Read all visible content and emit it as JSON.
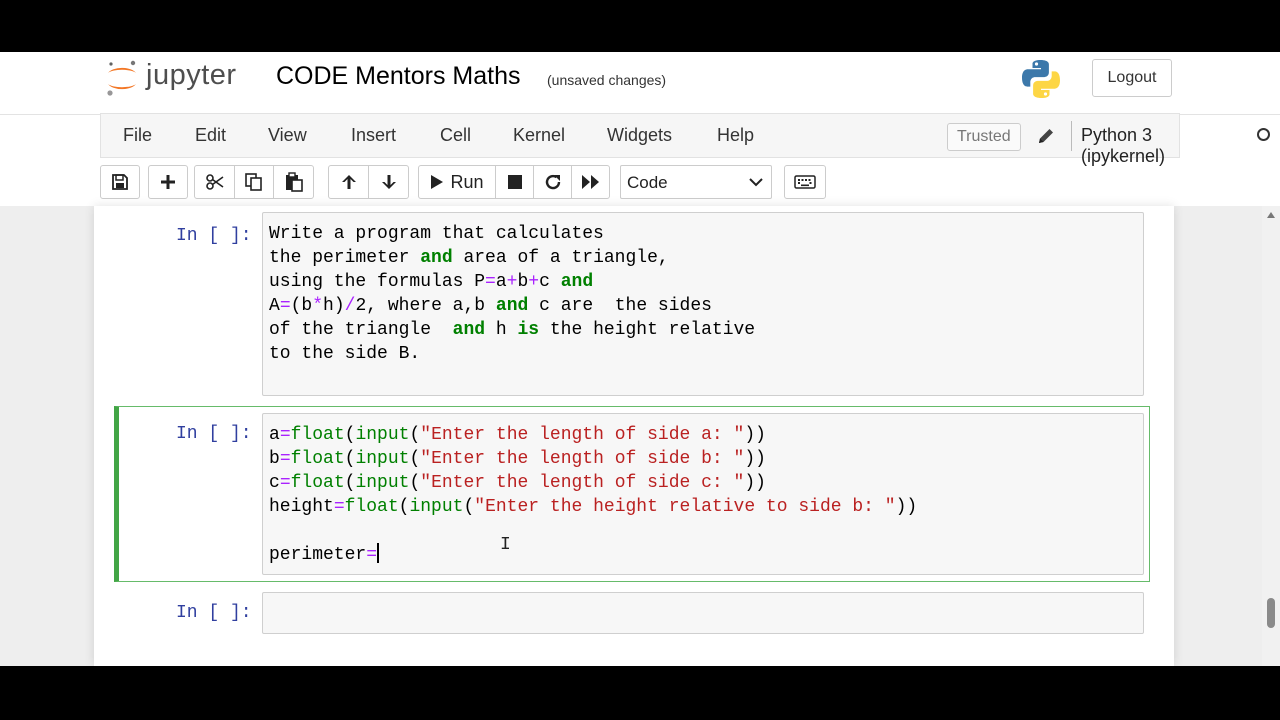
{
  "header": {
    "logo_text": "jupyter",
    "notebook_name": "CODE Mentors Maths",
    "save_status": "(unsaved changes)",
    "logout_label": "Logout"
  },
  "menubar": {
    "items": [
      "File",
      "Edit",
      "View",
      "Insert",
      "Cell",
      "Kernel",
      "Widgets",
      "Help"
    ],
    "trusted_label": "Trusted",
    "kernel_name": "Python 3 (ipykernel)"
  },
  "toolbar": {
    "run_label": "Run",
    "cell_type_value": "Code",
    "icons": [
      "save-icon",
      "plus-icon",
      "cut-icon",
      "copy-icon",
      "paste-icon",
      "arrow-up-icon",
      "arrow-down-icon",
      "run-icon",
      "stop-icon",
      "restart-icon",
      "fast-forward-icon",
      "keyboard-icon"
    ]
  },
  "cells": [
    {
      "prompt": "In [ ]:",
      "lines": [
        "Write a program that calculates",
        "the perimeter and area of a triangle,",
        "using the formulas P=a+b+c and",
        "A=(b*h)/2, where a,b and c are  the sides",
        "of the triangle  and h is the height relative",
        "to the side B."
      ]
    },
    {
      "prompt": "In [ ]:",
      "lines": [
        "a=float(input(\"Enter the length of side a: \"))",
        "b=float(input(\"Enter the length of side b: \"))",
        "c=float(input(\"Enter the length of side c: \"))",
        "height=float(input(\"Enter the height relative to side b: \"))",
        "",
        "perimeter="
      ],
      "selected": true
    },
    {
      "prompt": "In [ ]:",
      "lines": []
    }
  ],
  "colors": {
    "prompt": "#303f9f",
    "keyword": "#008000",
    "string": "#ba2121",
    "operator": "#aa22ff",
    "selected_border": "#42a546"
  }
}
